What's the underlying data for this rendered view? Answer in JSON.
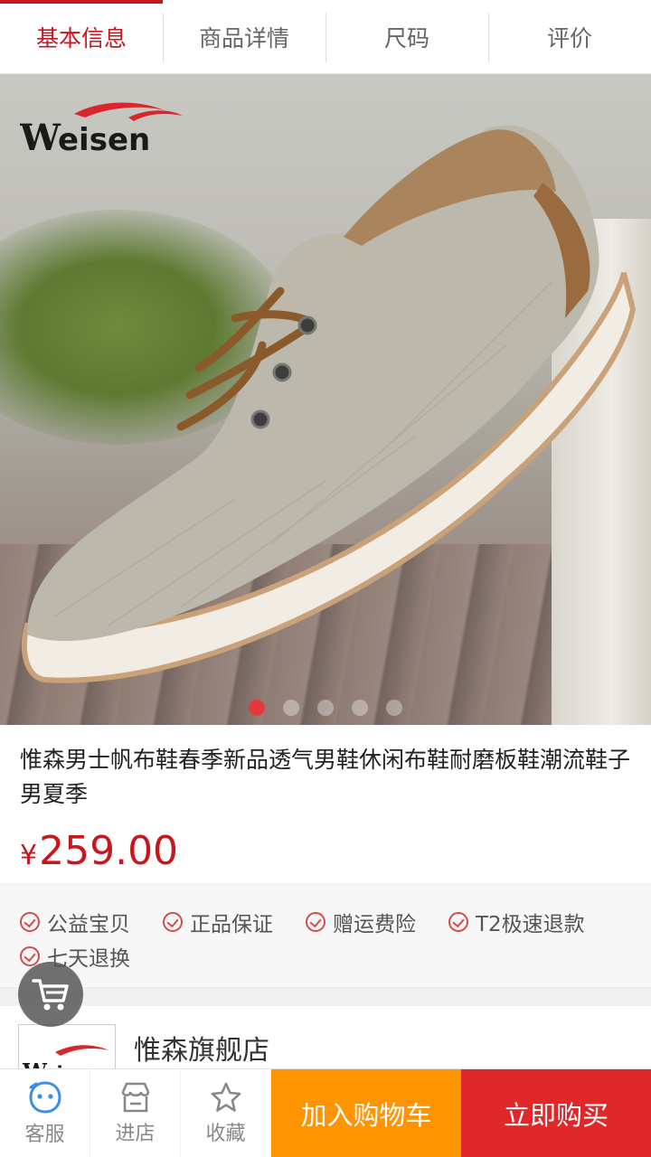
{
  "tabs": [
    {
      "label": "基本信息",
      "active": true
    },
    {
      "label": "商品详情",
      "active": false
    },
    {
      "label": "尺码",
      "active": false
    },
    {
      "label": "评价",
      "active": false
    }
  ],
  "hero": {
    "brand_logo_text": "Weisen",
    "carousel_count": 5,
    "carousel_active_index": 0
  },
  "product": {
    "title": "惟森男士帆布鞋春季新品透气男鞋休闲布鞋耐磨板鞋潮流鞋子男夏季",
    "currency": "¥",
    "price": "259.00"
  },
  "services": [
    "公益宝贝",
    "正品保证",
    "赠运费险",
    "T2极速退款",
    "七天退换"
  ],
  "store": {
    "name": "惟森旗舰店",
    "logo_text": "Weisen"
  },
  "bottom_bar": {
    "service_label": "客服",
    "store_label": "进店",
    "favorite_label": "收藏",
    "add_to_cart_label": "加入购物车",
    "buy_now_label": "立即购买"
  },
  "colors": {
    "accent_red": "#c8161d",
    "cart_orange": "#ff9402",
    "buy_red": "#e0282a"
  }
}
